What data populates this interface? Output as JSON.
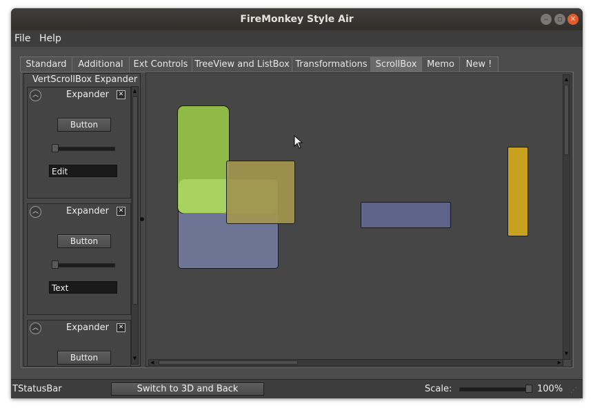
{
  "window": {
    "title": "FireMonkey Style Air"
  },
  "menu": {
    "items": [
      "File",
      "Help"
    ]
  },
  "tabs": [
    "Standard",
    "Additional",
    "Ext Controls",
    "TreeView and ListBox",
    "Transformations",
    "ScrollBox",
    "Memo",
    "New !"
  ],
  "active_tab": "ScrollBox",
  "left_panel": {
    "title": "VertScrollBox  Expander",
    "expanders": [
      {
        "title": "Expander",
        "button_label": "Button",
        "field_value": "Edit",
        "checked": true
      },
      {
        "title": "Expander",
        "button_label": "Button",
        "field_value": "Text",
        "checked": true
      },
      {
        "title": "Expander",
        "button_label": "Button",
        "checked": true
      }
    ]
  },
  "colors": {
    "green": "#8fba45",
    "light_green": "#a6d261",
    "slate": "#6e7494",
    "olive": "#9b9253",
    "blue_slate": "#5e6489",
    "gold": "#c8a11f"
  },
  "statusbar": {
    "label": "TStatusBar",
    "switch_button": "Switch to 3D and Back",
    "scale_label": "Scale:",
    "scale_value": "100%",
    "scale_fraction": 1.0
  },
  "icons": {
    "minimize": "minimize-icon",
    "maximize": "maximize-icon",
    "close": "close-icon",
    "expander_toggle": "chevron-up-icon",
    "checkbox": "checkbox-icon",
    "cursor": "mouse-pointer-icon"
  }
}
